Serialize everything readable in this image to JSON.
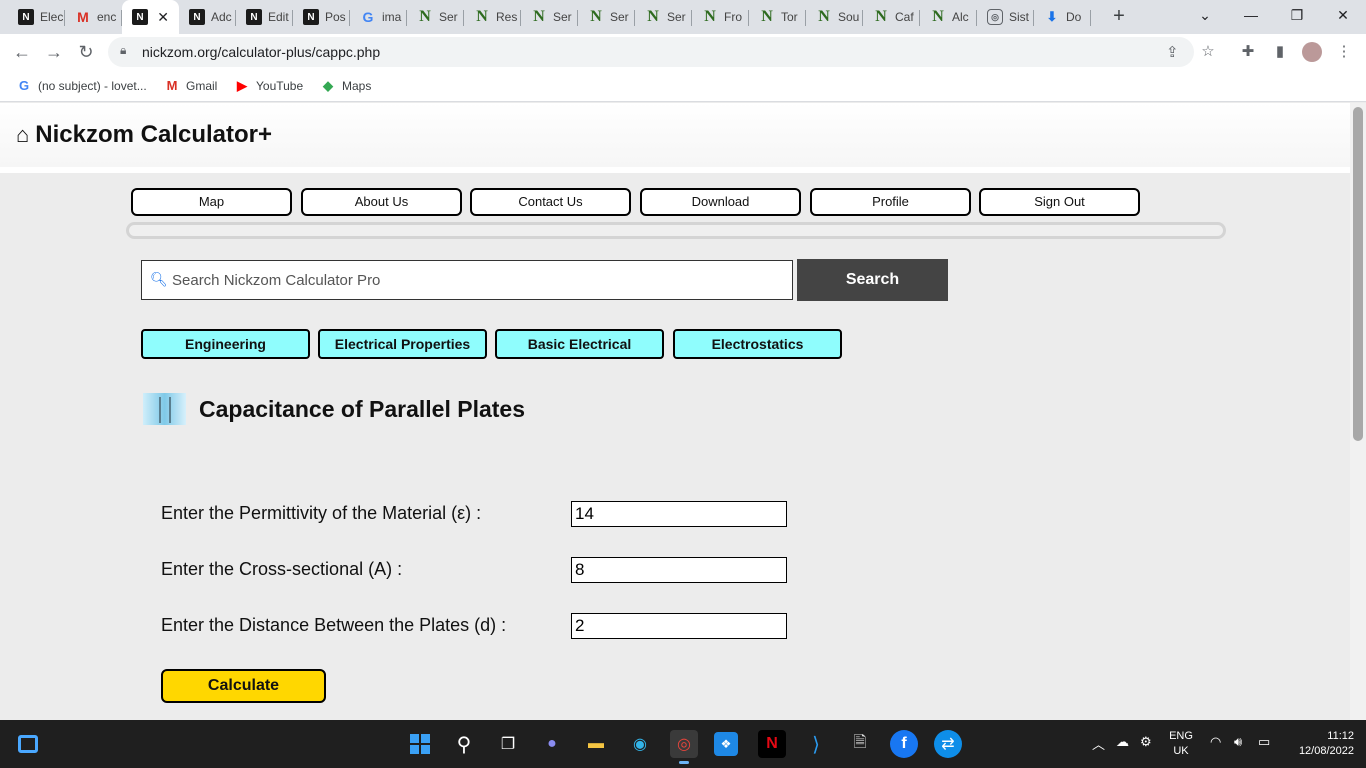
{
  "browser": {
    "tabs": [
      {
        "title": "Elec",
        "icon": "nickzom-icon",
        "style": "n-dark",
        "glyph": "N"
      },
      {
        "title": "enc",
        "icon": "gmail-icon",
        "style": "gmail",
        "glyph": "M"
      },
      {
        "title": "",
        "icon": "nickzom-icon",
        "style": "n-dark",
        "glyph": "N",
        "active": true
      },
      {
        "title": "Adc",
        "icon": "nickzom-icon",
        "style": "n-dark",
        "glyph": "N"
      },
      {
        "title": "Edit",
        "icon": "nickzom-icon",
        "style": "n-dark",
        "glyph": "N"
      },
      {
        "title": "Pos",
        "icon": "nickzom-icon",
        "style": "n-dark",
        "glyph": "N"
      },
      {
        "title": "ima",
        "icon": "google-icon",
        "style": "google",
        "glyph": "G"
      },
      {
        "title": "Ser",
        "icon": "nickzom-green-icon",
        "style": "n-green",
        "glyph": "N"
      },
      {
        "title": "Res",
        "icon": "nickzom-green-icon",
        "style": "n-green",
        "glyph": "N"
      },
      {
        "title": "Ser",
        "icon": "nickzom-green-icon",
        "style": "n-green",
        "glyph": "N"
      },
      {
        "title": "Ser",
        "icon": "nickzom-green-icon",
        "style": "n-green",
        "glyph": "N"
      },
      {
        "title": "Ser",
        "icon": "nickzom-green-icon",
        "style": "n-green",
        "glyph": "N"
      },
      {
        "title": "Fro",
        "icon": "nickzom-green-icon",
        "style": "n-green",
        "glyph": "N"
      },
      {
        "title": "Tor",
        "icon": "nickzom-green-icon",
        "style": "n-green",
        "glyph": "N"
      },
      {
        "title": "Sou",
        "icon": "nickzom-green-icon",
        "style": "n-green",
        "glyph": "N"
      },
      {
        "title": "Caf",
        "icon": "nickzom-green-icon",
        "style": "n-green",
        "glyph": "N"
      },
      {
        "title": "Alc",
        "icon": "nickzom-green-icon",
        "style": "n-green",
        "glyph": "N"
      },
      {
        "title": "Sist",
        "icon": "lens-icon",
        "style": "lens",
        "glyph": "◎"
      },
      {
        "title": "Do",
        "icon": "download-icon",
        "style": "down",
        "glyph": "⬇"
      }
    ],
    "url": "nickzom.org/calculator-plus/cappc.php",
    "bookmarks": [
      {
        "label": "(no subject) - lovet...",
        "icon": "google-icon",
        "glyph": "G",
        "color": "#4285f4"
      },
      {
        "label": "Gmail",
        "icon": "gmail-icon",
        "glyph": "M",
        "color": "#d93025"
      },
      {
        "label": "YouTube",
        "icon": "youtube-icon",
        "glyph": "▶",
        "color": "#ff0000"
      },
      {
        "label": "Maps",
        "icon": "maps-icon",
        "glyph": "◆",
        "color": "#34a853"
      }
    ]
  },
  "site": {
    "title": "Nickzom Calculator+",
    "nav": [
      "Map",
      "About Us",
      "Contact Us",
      "Download",
      "Profile",
      "Sign Out"
    ],
    "search": {
      "placeholder": "Search Nickzom Calculator Pro",
      "button": "Search"
    },
    "categories": [
      "Engineering",
      "Electrical Properties",
      "Basic Electrical",
      "Electrostatics"
    ],
    "calculator": {
      "heading": "Capacitance of Parallel Plates",
      "fields": [
        {
          "label": "Enter the Permittivity of the Material (ε) :",
          "value": "14"
        },
        {
          "label": "Enter the Cross-sectional (A) :",
          "value": "8"
        },
        {
          "label": "Enter the Distance Between the Plates (d) :",
          "value": "2"
        }
      ],
      "button": "Calculate"
    }
  },
  "taskbar": {
    "language": "ENG",
    "region": "UK",
    "time": "11:12",
    "date": "12/08/2022"
  },
  "colors": {
    "category_bg": "#8ffdfd",
    "calculate_bg": "#ffd700",
    "search_button_bg": "#444444"
  }
}
